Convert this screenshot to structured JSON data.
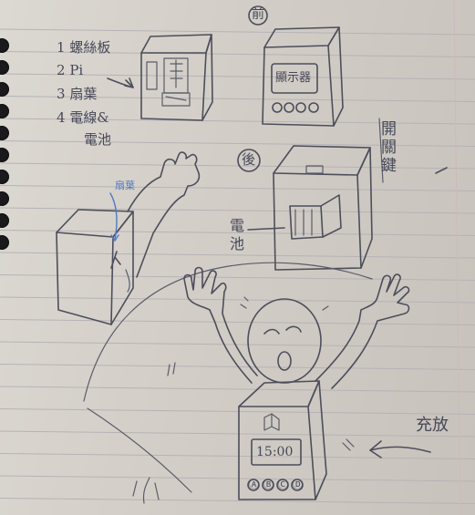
{
  "notes": {
    "list": [
      {
        "marker": "1",
        "text": "螺絲板"
      },
      {
        "marker": "2",
        "text": "Pi"
      },
      {
        "marker": "3",
        "text": "扇葉"
      },
      {
        "marker": "4",
        "text": "電線&"
      },
      {
        "marker": "",
        "text": "電池"
      }
    ]
  },
  "front_view": {
    "label": "前",
    "screen_text": "顯示器"
  },
  "back_view": {
    "label": "後",
    "switch_label": "開關鍵",
    "battery_label": "電池"
  },
  "side_view": {
    "fan_label": "扇葉"
  },
  "character": {
    "clock_text": "15:00",
    "button_marks": [
      "Ⓐ",
      "Ⓑ",
      "Ⓒ",
      "Ⓓ"
    ]
  },
  "side_note": {
    "text": "充放"
  }
}
